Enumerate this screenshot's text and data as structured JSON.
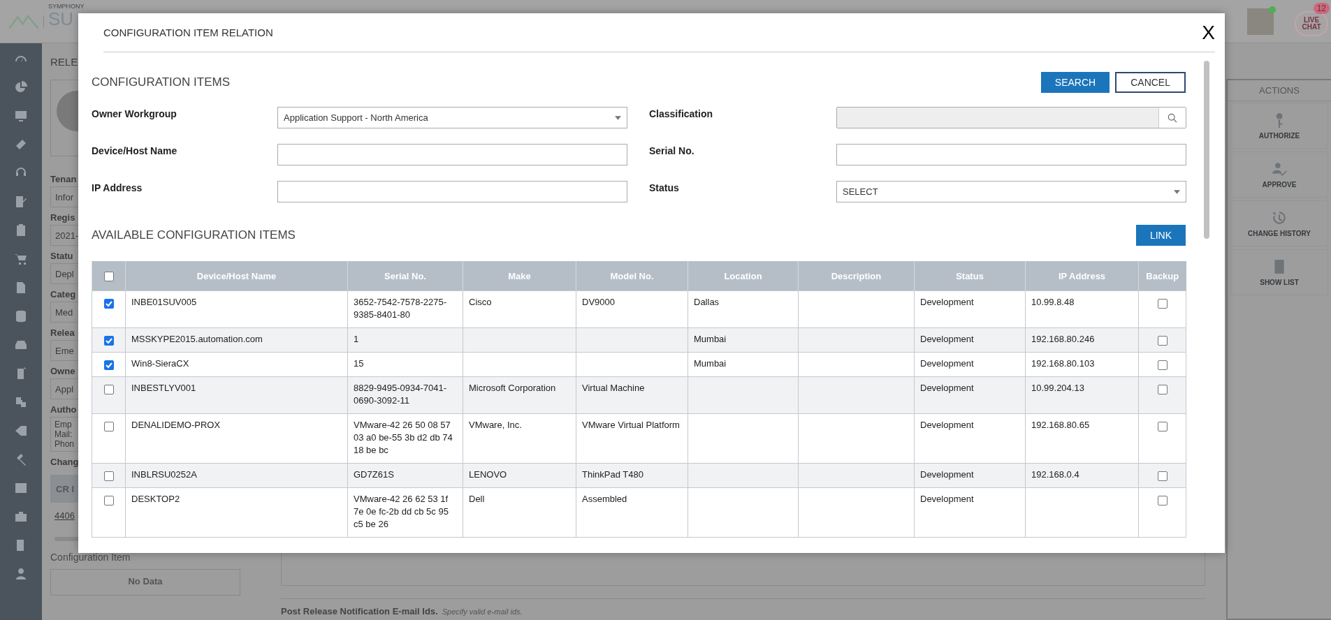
{
  "app": {
    "logo_small": "SYMPHONY",
    "logo_large": "SU",
    "chat_label": "LIVE CHAT",
    "chat_count": "12"
  },
  "side_panel": {
    "heading": "RELE",
    "fields": [
      {
        "label": "Tenan",
        "value": "Infor"
      },
      {
        "label": "Regis",
        "value": "2021-"
      },
      {
        "label": "Statu",
        "value": "Depl"
      },
      {
        "label": "Categ",
        "value": "Med"
      },
      {
        "label": "Relea",
        "value": "Eme"
      },
      {
        "label": "Owne",
        "value": "Appl"
      }
    ],
    "author_label": "Autho",
    "author_lines": [
      "Emp",
      "Mail:",
      "Phon"
    ],
    "change_label": "Chang",
    "cr_header": "CR I",
    "cr_link": "4406",
    "config_label": "Configuration Item",
    "config_empty": "No Data"
  },
  "notification": {
    "label": "Post Release Notification E-mail Ids.",
    "hint": "Specify valid e-mail ids."
  },
  "actions": {
    "title": "ACTIONS",
    "items": [
      {
        "label": "AUTHORIZE",
        "kind": "key"
      },
      {
        "label": "APPROVE",
        "kind": "approve"
      },
      {
        "label": "CHANGE HISTORY",
        "kind": "history"
      },
      {
        "label": "SHOW LIST",
        "kind": "list"
      }
    ]
  },
  "modal": {
    "title": "CONFIGURATION ITEM RELATION",
    "close": "X",
    "section": "CONFIGURATION ITEMS",
    "buttons": [
      {
        "label": "SEARCH",
        "kind": "primary"
      },
      {
        "label": "CANCEL",
        "kind": "outline"
      }
    ],
    "fields": [
      {
        "label": "Owner Workgroup",
        "kind": "select",
        "value": "Application Support - North America"
      },
      {
        "label": "Classification",
        "kind": "lookup"
      },
      {
        "label": "Device/Host Name",
        "kind": "text"
      },
      {
        "label": "Serial No.",
        "kind": "text"
      },
      {
        "label": "IP Address",
        "kind": "text"
      },
      {
        "label": "Status",
        "kind": "select",
        "value": "SELECT"
      }
    ],
    "list_title": "AVAILABLE CONFIGURATION ITEMS",
    "link_button": "LINK",
    "table": {
      "select_all": false,
      "columns": [
        "Device/Host Name",
        "Serial No.",
        "Make",
        "Model No.",
        "Location",
        "Description",
        "Status",
        "IP Address",
        "Backup"
      ],
      "rows": [
        {
          "selected": true,
          "backup": false,
          "cells": [
            "INBE01SUV005",
            "3652-7542-7578-2275-9385-8401-80",
            "Cisco",
            "DV9000",
            "Dallas",
            "",
            "Development",
            "10.99.8.48"
          ]
        },
        {
          "selected": true,
          "backup": false,
          "cells": [
            "MSSKYPE2015.automation.com",
            "1",
            "",
            "",
            "Mumbai",
            "",
            "Development",
            "192.168.80.246"
          ]
        },
        {
          "selected": true,
          "backup": false,
          "cells": [
            "Win8-SieraCX",
            "15",
            "",
            "",
            "Mumbai",
            "",
            "Development",
            "192.168.80.103"
          ]
        },
        {
          "selected": false,
          "backup": false,
          "cells": [
            "INBESTLYV001",
            "8829-9495-0934-7041-0690-3092-11",
            "Microsoft Corporation",
            "Virtual Machine",
            "",
            "",
            "Development",
            "10.99.204.13"
          ]
        },
        {
          "selected": false,
          "backup": false,
          "cells": [
            "DENALIDEMO-PROX",
            "VMware-42 26 50 08 57 03 a0 be-55 3b d2 db 74 18 be bc",
            "VMware, Inc.",
            "VMware Virtual Platform",
            "",
            "",
            "Development",
            "192.168.80.65"
          ]
        },
        {
          "selected": false,
          "backup": false,
          "cells": [
            "INBLRSU0252A",
            "GD7Z61S",
            "LENOVO",
            "ThinkPad T480",
            "",
            "",
            "Development",
            "192.168.0.4"
          ]
        },
        {
          "selected": false,
          "backup": false,
          "cells": [
            "DESKTOP2",
            "VMware-42 26 62 53 1f 7e 0e fc-2b dd cb 5c 95 c5 be 26",
            "Dell",
            "Assembled",
            "",
            "",
            "Development",
            ""
          ]
        }
      ]
    }
  }
}
